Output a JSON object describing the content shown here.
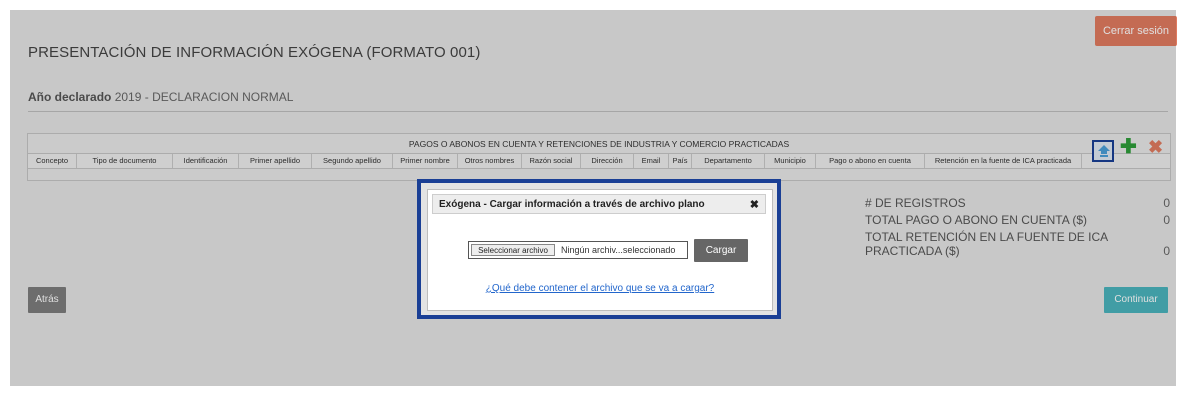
{
  "header": {
    "logout_label": "Cerrar sesión",
    "title": "PRESENTACIÓN DE INFORMACIÓN EXÓGENA (FORMATO 001)"
  },
  "year": {
    "label": "Año declarado",
    "value": "2019 - DECLARACION NORMAL"
  },
  "table": {
    "caption": "PAGOS O ABONOS EN CUENTA Y RETENCIONES DE INDUSTRIA Y COMERCIO PRACTICADAS",
    "columns": [
      "Concepto",
      "Tipo de documento",
      "Identificación",
      "Primer apellido",
      "Segundo apellido",
      "Primer nombre",
      "Otros nombres",
      "Razón social",
      "Dirección",
      "Email",
      "País",
      "Departamento",
      "Municipio",
      "Pago o abono en cuenta",
      "Retención en la fuente de ICA practicada"
    ],
    "toolbar": {
      "upload_icon": "upload-file-icon",
      "add_icon": "plus-icon",
      "delete_icon": "close-icon"
    }
  },
  "stats": {
    "records_label": "# DE REGISTROS",
    "records_value": "0",
    "total_payment_label": "TOTAL PAGO O ABONO EN CUENTA ($)",
    "total_payment_value": "0",
    "total_retention_label": "TOTAL RETENCIÓN EN LA FUENTE DE ICA PRACTICADA ($)",
    "total_retention_value": "0"
  },
  "actions": {
    "back_label": "Atrás",
    "continue_label": "Continuar"
  },
  "dialog": {
    "title": "Exógena - Cargar información a través de archivo plano",
    "close_glyph": "✖",
    "file_button_label": "Seleccionar archivo",
    "file_status": "Ningún archiv...seleccionado",
    "load_label": "Cargar",
    "help_link": "¿Qué debe contener el archivo que se va a cargar?"
  },
  "colors": {
    "logout": "#e07a5f",
    "continue": "#4ab3bc",
    "highlight_border": "#1a3f95",
    "add": "#2e9c3a",
    "delete": "#e07a5f"
  }
}
